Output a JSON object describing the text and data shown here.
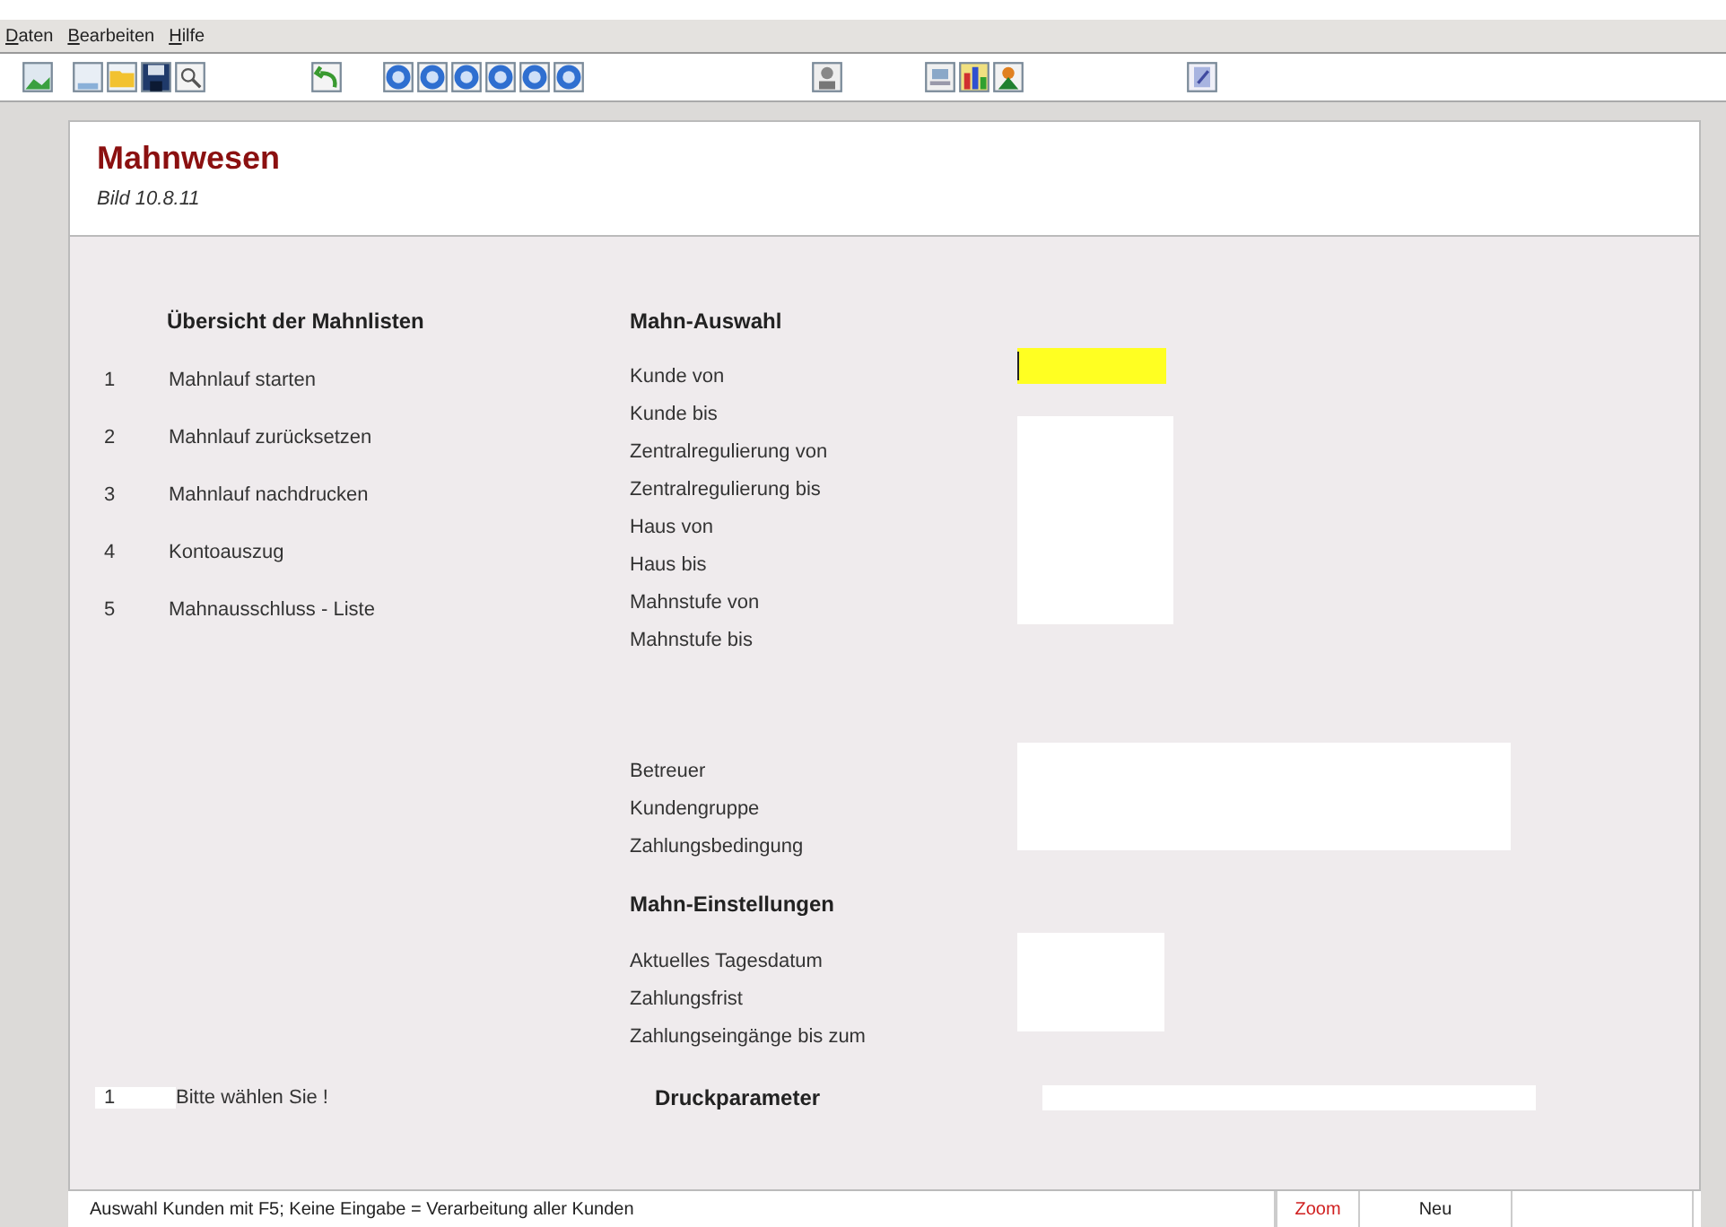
{
  "menu": [
    {
      "label": "Daten"
    },
    {
      "label": "Bearbeiten"
    },
    {
      "label": "Hilfe"
    }
  ],
  "header": {
    "title": "Mahnwesen",
    "subtitle": "Bild 10.8.11"
  },
  "overview": {
    "heading": "Übersicht der Mahnlisten",
    "items": [
      {
        "number": "1",
        "label": "Mahnlauf starten"
      },
      {
        "number": "2",
        "label": "Mahnlauf zurücksetzen"
      },
      {
        "number": "3",
        "label": "Mahnlauf nachdrucken"
      },
      {
        "number": "4",
        "label": "Kontoauszug"
      },
      {
        "number": "5",
        "label": "Mahnausschluss - Liste"
      }
    ]
  },
  "selection": {
    "heading": "Mahn-Auswahl",
    "labels": [
      "Kunde von",
      "Kunde bis",
      "Zentralregulierung von",
      "Zentralregulierung bis",
      "Haus von",
      "Haus bis",
      "Mahnstufe von",
      "Mahnstufe bis"
    ],
    "focused": true
  },
  "extra": {
    "labels": [
      "Betreuer",
      "Kundengruppe",
      "Zahlungsbedingung"
    ]
  },
  "settings": {
    "heading": "Mahn-Einstellungen",
    "labels": [
      "Aktuelles Tagesdatum",
      "Zahlungsfrist",
      "Zahlungseingänge bis zum"
    ]
  },
  "choice": {
    "value": "1",
    "label": "Bitte wählen Sie !"
  },
  "print": {
    "heading": "Druckparameter"
  },
  "status_bar": {
    "message": "Auswahl Kunden mit F5;  Keine Eingabe = Verarbeitung aller Kunden",
    "zoom": "Zoom",
    "mode": "Neu"
  }
}
